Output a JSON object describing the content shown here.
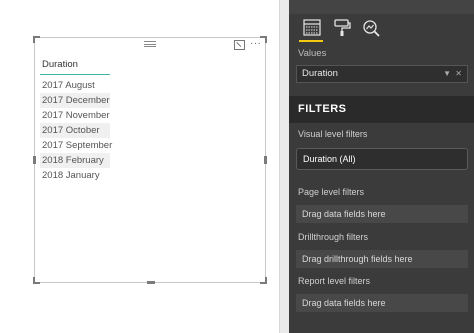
{
  "slicer": {
    "header": "Duration",
    "items": [
      {
        "label": "2017 August",
        "shaded": false
      },
      {
        "label": "2017 December",
        "shaded": true
      },
      {
        "label": "2017 November",
        "shaded": false
      },
      {
        "label": "2017 October",
        "shaded": true
      },
      {
        "label": "2017 September",
        "shaded": false
      },
      {
        "label": "2018 February",
        "shaded": true
      },
      {
        "label": "2018 January",
        "shaded": false
      }
    ],
    "more_label": "···"
  },
  "pane": {
    "tabs": [
      {
        "icon": "fields-icon",
        "active": true
      },
      {
        "icon": "format-roller-icon",
        "active": false
      },
      {
        "icon": "analytics-magnifier-icon",
        "active": false
      }
    ],
    "values_label": "Values",
    "value_field": "Duration",
    "filters_title": "FILTERS",
    "visual_filters_label": "Visual level filters",
    "visual_filter_chip": "Duration  (All)",
    "page_filters_label": "Page level filters",
    "page_drop": "Drag data fields here",
    "drill_label": "Drillthrough filters",
    "drill_drop": "Drag drillthrough fields here",
    "report_label": "Report level filters",
    "report_drop": "Drag data fields here"
  },
  "colors": {
    "accent": "#f2c811",
    "slicer_rule": "#41b6a8",
    "pane_bg": "#3b3b3b"
  }
}
